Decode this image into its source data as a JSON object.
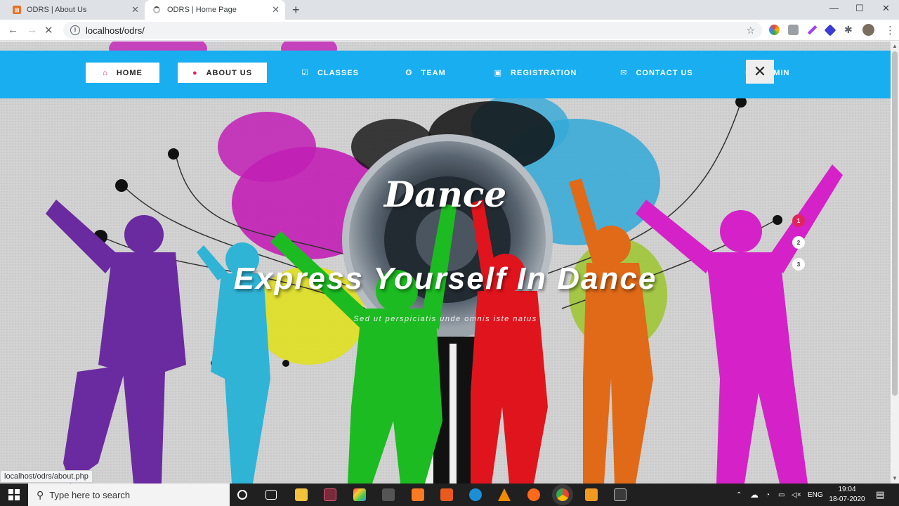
{
  "browser": {
    "tabs": [
      {
        "title": "ODRS | About Us",
        "active": false
      },
      {
        "title": "ODRS | Home Page",
        "active": true
      }
    ],
    "url": "localhost/odrs/",
    "status_url": "localhost/odrs/about.php"
  },
  "nav": {
    "items": [
      {
        "label": "HOME",
        "icon": "home-icon",
        "active": true
      },
      {
        "label": "ABOUT US",
        "icon": "user-icon",
        "active": true
      },
      {
        "label": "CLASSES",
        "icon": "check-square-icon",
        "active": false
      },
      {
        "label": "TEAM",
        "icon": "users-icon",
        "active": false
      },
      {
        "label": "REGISTRATION",
        "icon": "image-icon",
        "active": false
      },
      {
        "label": "CONTACT US",
        "icon": "envelope-icon",
        "active": false
      },
      {
        "label": "ADMIN",
        "icon": "gear-icon",
        "active": false
      }
    ],
    "color": "#18aef0"
  },
  "hero": {
    "logo_text": "Dance",
    "headline": "Express Yourself In Dance",
    "subline": "Sed ut perspiciatis unde omnis iste natus",
    "slides": [
      "1",
      "2",
      "3"
    ],
    "active_slide": "1",
    "accent": "#e0245e"
  },
  "taskbar": {
    "search_placeholder": "Type here to search",
    "language": "ENG",
    "time": "19:04",
    "date": "18-07-2020"
  }
}
